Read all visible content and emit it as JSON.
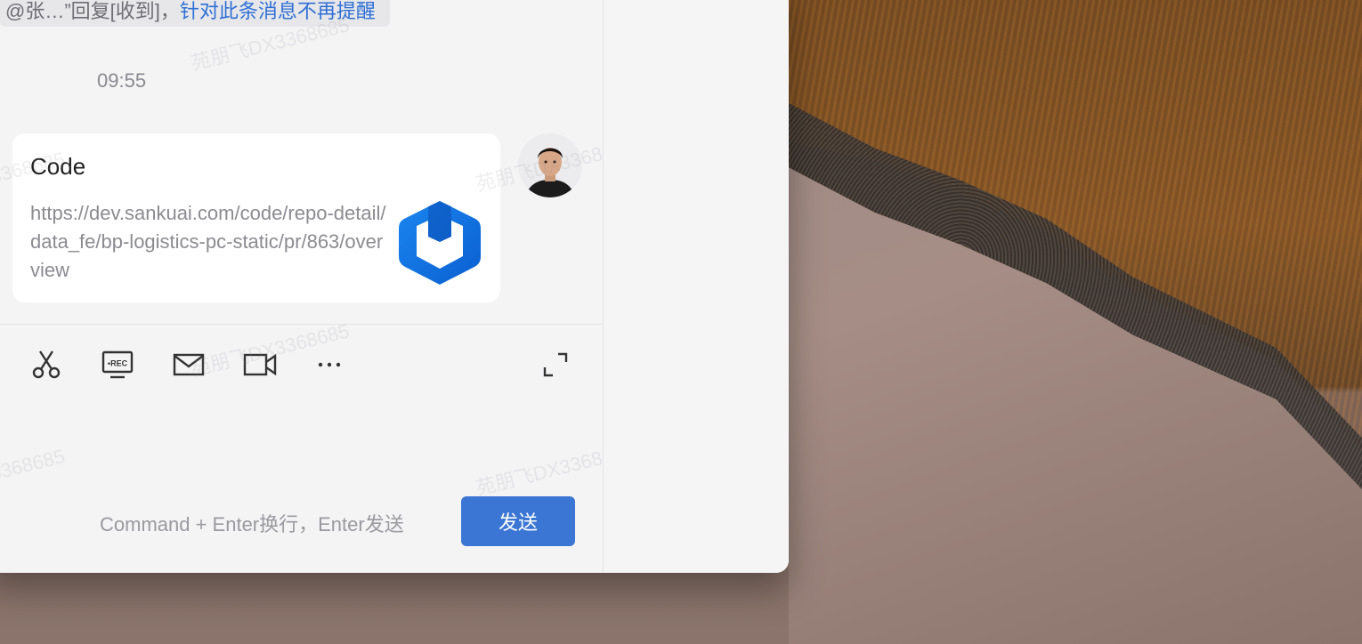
{
  "chat": {
    "reply_notice_prefix": "@张…”回复[收到]，",
    "reply_notice_link": "针对此条消息不再提醒",
    "timestamp": "09:55",
    "link_card": {
      "title": "Code",
      "url": "https://dev.sankuai.com/code/repo-detail/data_fe/bp-logistics-pc-static/pr/863/overview",
      "logo_icon": "code-app-logo-icon"
    },
    "avatar_icon": "user-avatar"
  },
  "toolbar": {
    "icons": [
      "scissors-icon",
      "screen-record-icon",
      "mail-icon",
      "video-camera-icon",
      "more-icon",
      "expand-icon"
    ]
  },
  "composer": {
    "hint": "Command + Enter换行，Enter发送",
    "send_label": "发送"
  },
  "watermark": {
    "text": "苑朋飞DX3368685",
    "fragment": "3368685"
  },
  "colors": {
    "link": "#2f6fd6",
    "send_button": "#3b76d4",
    "code_logo": "#1677e8"
  }
}
